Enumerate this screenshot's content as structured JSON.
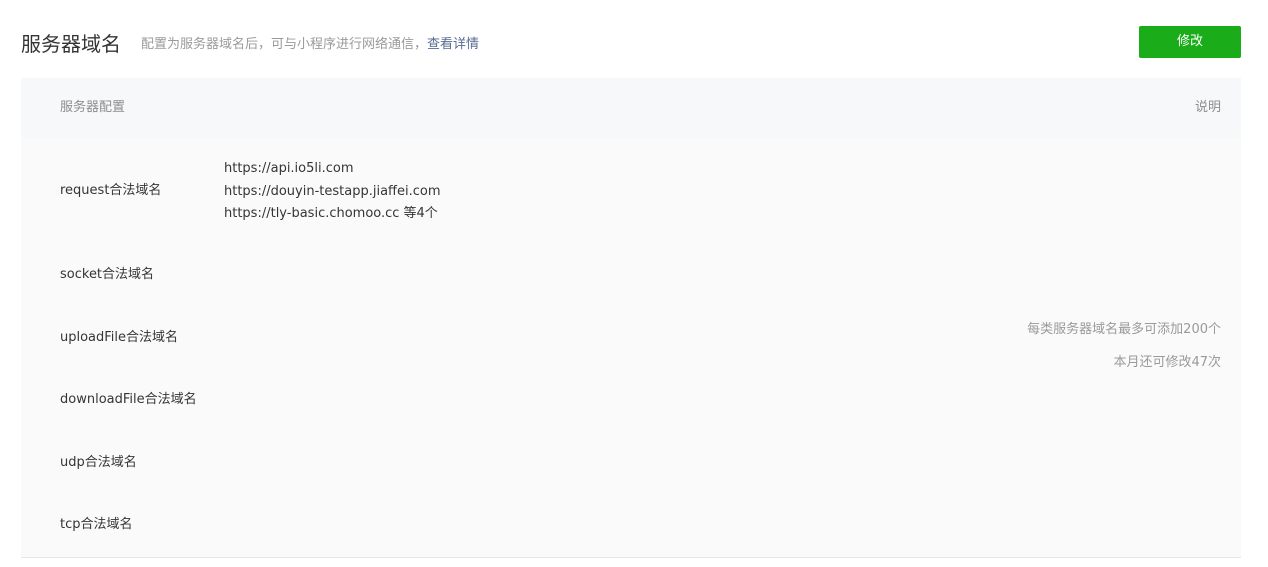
{
  "header": {
    "title": "服务器域名",
    "description": "配置为服务器域名后，可与小程序进行网络通信，",
    "details_link": "查看详情",
    "edit_button": "修改"
  },
  "table": {
    "columns": {
      "config": "服务器配置",
      "notes": "说明"
    },
    "rows": [
      {
        "label": "request合法域名",
        "domains": [
          "https://api.io5li.com",
          "https://douyin-testapp.jiaffei.com",
          "https://tly-basic.chomoo.cc"
        ],
        "more": "等4个"
      },
      {
        "label": "socket合法域名",
        "domains": []
      },
      {
        "label": "uploadFile合法域名",
        "domains": []
      },
      {
        "label": "downloadFile合法域名",
        "domains": []
      },
      {
        "label": "udp合法域名",
        "domains": []
      },
      {
        "label": "tcp合法域名",
        "domains": []
      }
    ],
    "notes": [
      "每类服务器域名最多可添加200个",
      "本月还可修改47次"
    ]
  }
}
